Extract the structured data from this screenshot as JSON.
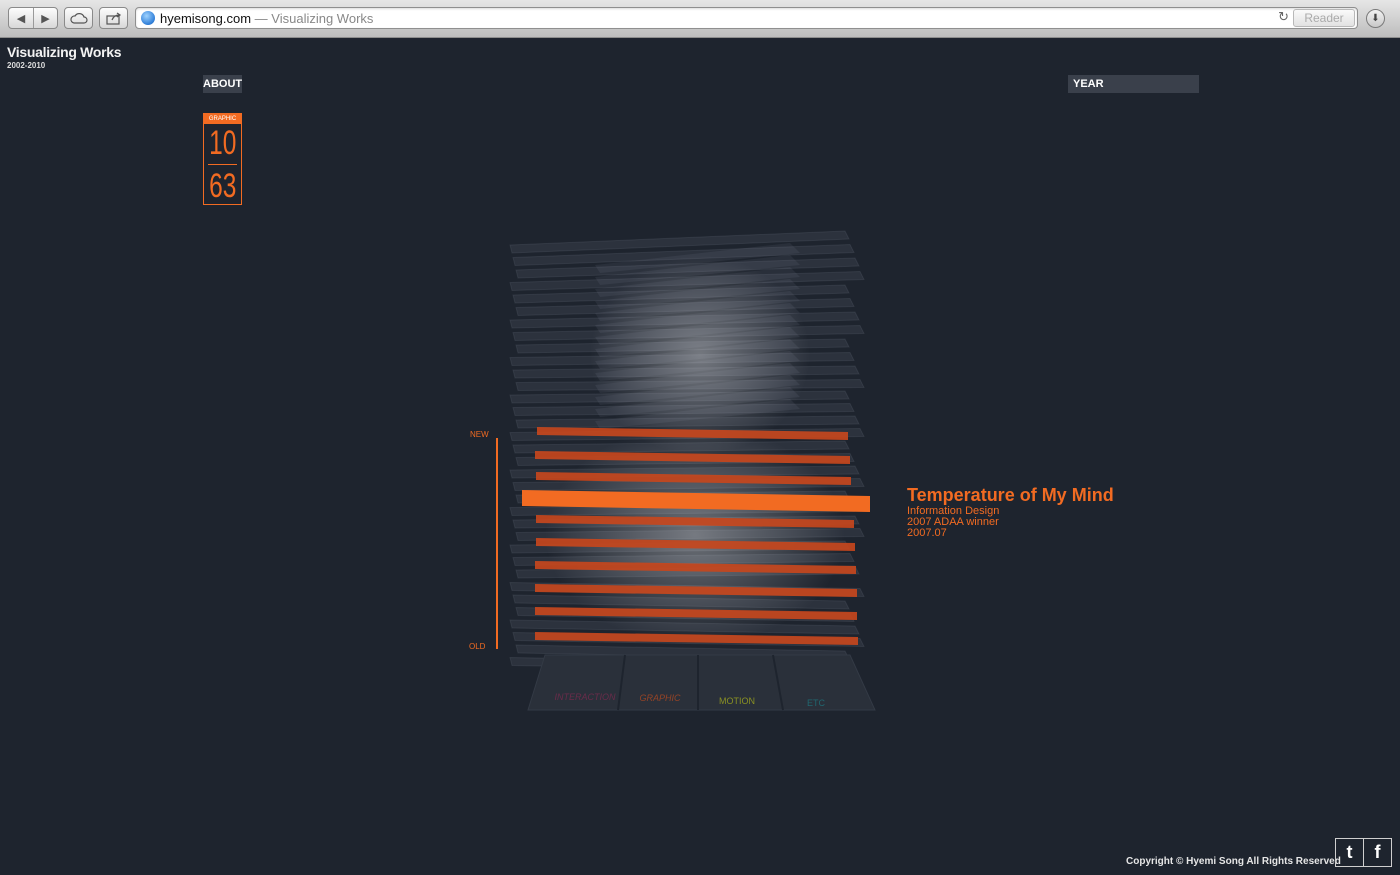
{
  "browser": {
    "url_domain": "hyemisong.com",
    "url_separator": " — ",
    "page_title": "Visualizing Works",
    "reader_label": "Reader",
    "icons": [
      "back-icon",
      "forward-icon",
      "icloud-icon",
      "share-icon",
      "globe-icon",
      "reload-icon",
      "download-icon"
    ]
  },
  "site": {
    "title": "Visualizing Works",
    "years": "2002-2010"
  },
  "nav": {
    "about_label": "ABOUT",
    "year_label": "YEAR"
  },
  "counter": {
    "category": "GRAPHIC",
    "current": "10",
    "total": "63",
    "color": "#f26b22"
  },
  "timeline": {
    "new_label": "NEW",
    "old_label": "OLD"
  },
  "categories": [
    {
      "label": "INTERACTION",
      "color": "#b5265e"
    },
    {
      "label": "GRAPHIC",
      "color": "#c24c1e"
    },
    {
      "label": "MOTION",
      "color": "#9aa11f"
    },
    {
      "label": "ETC",
      "color": "#1a8b93"
    }
  ],
  "selected_work": {
    "title": "Temperature of My Mind",
    "category": "Information Design",
    "award": "2007 ADAA winner",
    "date": "2007.07"
  },
  "footer": {
    "copyright": "Copyright © Hyemi Song All Rights Reserved",
    "twitter_label": "t",
    "facebook_label": "f"
  },
  "colors": {
    "background": "#1e242e",
    "accent": "#f26b22"
  }
}
